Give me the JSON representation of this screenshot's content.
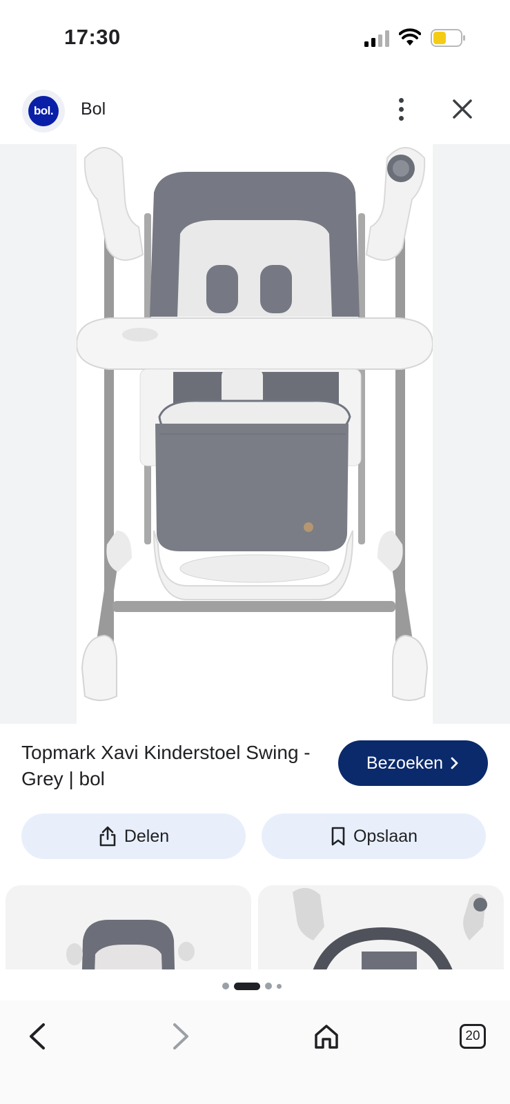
{
  "status_bar": {
    "time": "17:30",
    "battery_color": "#f5cc15"
  },
  "header": {
    "site_name": "Bol",
    "logo_text": "bol."
  },
  "result": {
    "title": "Topmark Xavi Kinderstoel Swing - Grey | bol",
    "visit_label": "Bezoeken",
    "visit_color": "#0b2a6b"
  },
  "actions": {
    "share_label": "Delen",
    "save_label": "Opslaan"
  },
  "pager": {
    "total": 4,
    "active_index": 1
  },
  "bottom_nav": {
    "tab_count": "20"
  },
  "icons": [
    "signal-icon",
    "wifi-icon",
    "battery-icon",
    "more-icon",
    "close-icon",
    "share-icon",
    "bookmark-icon",
    "back-icon",
    "forward-icon",
    "home-icon",
    "tabs-icon",
    "chevron-right-icon"
  ]
}
